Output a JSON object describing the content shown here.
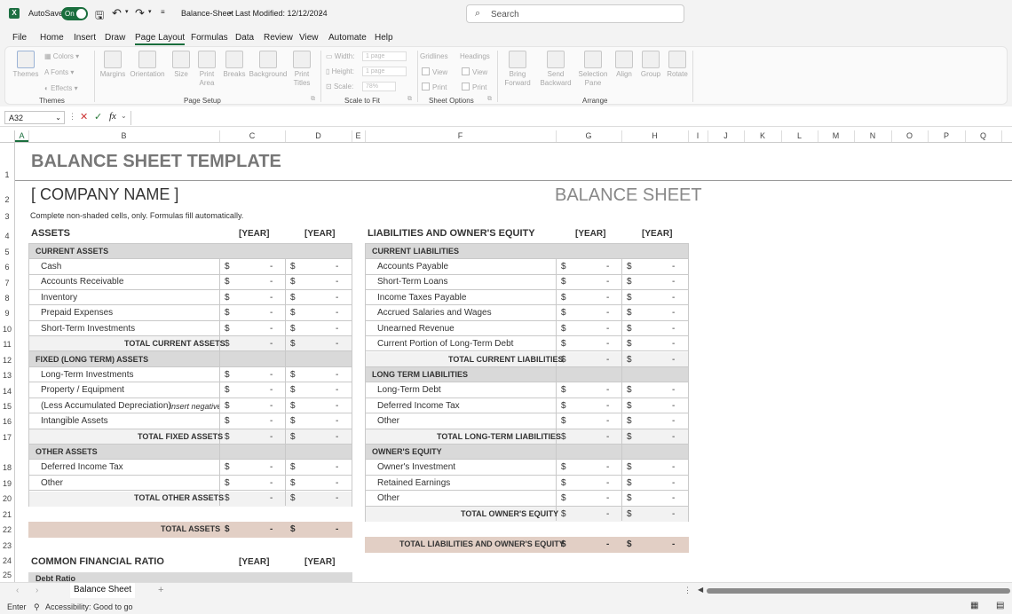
{
  "titlebar": {
    "autosave_label": "AutoSave",
    "autosave_state": "On",
    "file_name": "Balance-Sheet",
    "separator": "•",
    "modified": "Last Modified: 12/12/2024",
    "search_placeholder": "Search"
  },
  "menu": [
    "File",
    "Home",
    "Insert",
    "Draw",
    "Page Layout",
    "Formulas",
    "Data",
    "Review",
    "View",
    "Automate",
    "Help"
  ],
  "menu_active": "Page Layout",
  "ribbon": {
    "themes_group": {
      "name": "Themes",
      "themes": "Themes",
      "colors": "Colors",
      "fonts": "Fonts",
      "effects": "Effects"
    },
    "page_setup_group": {
      "name": "Page Setup",
      "buttons": [
        "Margins",
        "Orientation",
        "Size",
        "Print Area",
        "Breaks",
        "Background",
        "Print Titles"
      ]
    },
    "scale_group": {
      "name": "Scale to Fit",
      "width_label": "Width:",
      "width_value": "1 page",
      "height_label": "Height:",
      "height_value": "1 page",
      "scale_label": "Scale:",
      "scale_value": "78%"
    },
    "sheet_options_group": {
      "name": "Sheet Options",
      "gridlines": "Gridlines",
      "headings": "Headings",
      "view": "View",
      "print": "Print"
    },
    "arrange_group": {
      "name": "Arrange",
      "buttons": [
        "Bring Forward",
        "Send Backward",
        "Selection Pane",
        "Align",
        "Group",
        "Rotate"
      ]
    }
  },
  "formula_bar": {
    "name_box": "A32",
    "fx": "fx"
  },
  "columns": [
    "A",
    "B",
    "C",
    "D",
    "E",
    "F",
    "G",
    "H",
    "I",
    "J",
    "K",
    "L",
    "M",
    "N",
    "O",
    "P",
    "Q"
  ],
  "rows": [
    "1",
    "2",
    "3",
    "4",
    "5",
    "6",
    "7",
    "8",
    "9",
    "10",
    "11",
    "12",
    "13",
    "14",
    "15",
    "16",
    "17",
    "18",
    "19",
    "20",
    "21",
    "22",
    "23",
    "24",
    "25"
  ],
  "sheet": {
    "title": "BALANCE SHEET TEMPLATE",
    "company": "[ COMPANY NAME ]",
    "right_title": "BALANCE SHEET",
    "instructions": "Complete non-shaded cells, only.  Formulas fill automatically.",
    "year": "[YEAR]",
    "currency": "$",
    "blank": "-",
    "assets": {
      "header": "ASSETS",
      "current": {
        "label": "CURRENT ASSETS",
        "items": [
          "Cash",
          "Accounts Receivable",
          "Inventory",
          "Prepaid Expenses",
          "Short-Term Investments"
        ],
        "total": "TOTAL CURRENT ASSETS"
      },
      "fixed": {
        "label": "FIXED (LONG TERM) ASSETS",
        "items": [
          "Long-Term Investments",
          "Property / Equipment",
          "(Less Accumulated Depreciation)",
          "Intangible Assets"
        ],
        "note": "insert negative",
        "total": "TOTAL FIXED ASSETS"
      },
      "other": {
        "label": "OTHER ASSETS",
        "items": [
          "Deferred Income Tax",
          "Other"
        ],
        "total": "TOTAL OTHER ASSETS"
      },
      "grand_total": "TOTAL ASSETS"
    },
    "liabilities": {
      "header": "LIABILITIES AND OWNER'S EQUITY",
      "current": {
        "label": "CURRENT LIABILITIES",
        "items": [
          "Accounts Payable",
          "Short-Term Loans",
          "Income Taxes Payable",
          "Accrued Salaries and Wages",
          "Unearned Revenue",
          "Current Portion of Long-Term Debt"
        ],
        "total": "TOTAL CURRENT LIABILITIES"
      },
      "long_term": {
        "label": "LONG TERM LIABILITIES",
        "items": [
          "Long-Term Debt",
          "Deferred Income Tax",
          "Other"
        ],
        "total": "TOTAL LONG-TERM LIABILITIES"
      },
      "equity": {
        "label": "OWNER'S EQUITY",
        "items": [
          "Owner's Investment",
          "Retained Earnings",
          "Other"
        ],
        "total": "TOTAL OWNER'S EQUITY"
      },
      "grand_total": "TOTAL LIABILITIES AND OWNER'S EQUITY"
    },
    "ratio": {
      "header": "COMMON FINANCIAL RATIO",
      "first_row": "Debt Ratio"
    }
  },
  "tabs": {
    "sheet_name": "Balance Sheet",
    "add": "+"
  },
  "status": {
    "mode": "Enter",
    "accessibility": "Accessibility: Good to go"
  }
}
